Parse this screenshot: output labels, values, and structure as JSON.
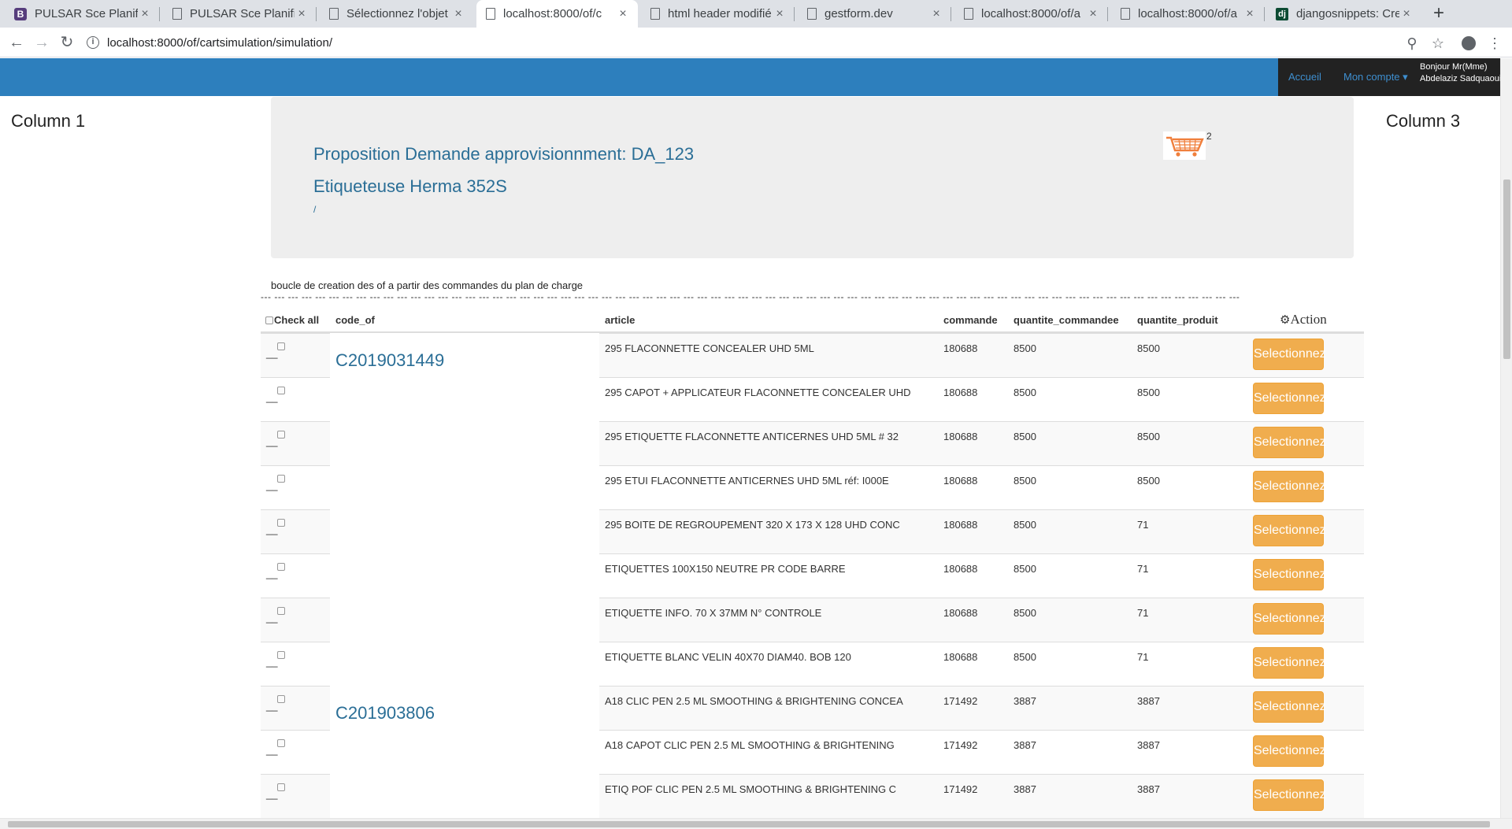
{
  "browser": {
    "tabs": [
      {
        "title": "PULSAR Sce Planific",
        "favicon": "bootstrap-icon"
      },
      {
        "title": "PULSAR Sce Planific",
        "favicon": "document-icon"
      },
      {
        "title": "Sélectionnez l'objet",
        "favicon": "document-icon"
      },
      {
        "title": "localhost:8000/of/c",
        "favicon": "document-icon",
        "active": true
      },
      {
        "title": "html header modifié",
        "favicon": "document-icon"
      },
      {
        "title": "gestform.dev",
        "favicon": "document-icon"
      },
      {
        "title": "localhost:8000/of/a",
        "favicon": "document-icon"
      },
      {
        "title": "localhost:8000/of/a",
        "favicon": "document-icon"
      },
      {
        "title": "djangosnippets: Crea",
        "favicon": "django-icon"
      }
    ],
    "close_glyph": "×",
    "new_tab_glyph": "+",
    "url": "localhost:8000/of/cartsimulation/simulation/",
    "info_glyph": "i"
  },
  "navbar": {
    "home": "Accueil",
    "account": "Mon compte ▾",
    "greeting_line1": "Bonjour Mr(Mme)",
    "greeting_line2": "Abdelaziz Sadquaoui",
    "color": "#2d7fbd"
  },
  "columns": {
    "left": "Column 1",
    "right": "Column 3"
  },
  "jumbotron": {
    "title": "Proposition Demande approvisionnment: DA_123",
    "subtitle": "Etiqueteuse Herma 352S",
    "path": "/",
    "cart_count": "2"
  },
  "loop_note": "boucle de creation des of a partir des commandes du plan de charge",
  "dashes": "--- --- --- --- --- --- --- --- --- --- --- --- --- --- --- --- --- --- --- --- --- --- --- --- --- --- --- --- --- --- --- --- --- --- --- --- --- --- --- --- --- --- --- --- --- --- --- --- --- --- --- --- --- --- --- --- --- --- --- --- --- --- --- --- --- --- --- --- --- --- --- ---",
  "table": {
    "headers": {
      "check_all": "Check all",
      "code_of": "code_of",
      "article": "article",
      "commande": "commande",
      "quantite_commandee": "quantite_commandee",
      "quantite_produit": "quantite_produit",
      "action": "Action"
    },
    "button_label": "Selectionnez",
    "row_marker": "__",
    "groups": [
      {
        "code_of": "C2019031449",
        "rows": [
          {
            "article": "295 FLACONNETTE CONCEALER UHD 5ML",
            "commande": "180688",
            "qte_cmd": "8500",
            "qte_prod": "8500"
          },
          {
            "article": "295 CAPOT + APPLICATEUR FLACONNETTE CONCEALER UHD",
            "commande": "180688",
            "qte_cmd": "8500",
            "qte_prod": "8500"
          },
          {
            "article": "295 ETIQUETTE FLACONNETTE ANTICERNES UHD 5ML # 32",
            "commande": "180688",
            "qte_cmd": "8500",
            "qte_prod": "8500"
          },
          {
            "article": "295 ETUI FLACONNETTE ANTICERNES UHD 5ML réf: I000E",
            "commande": "180688",
            "qte_cmd": "8500",
            "qte_prod": "8500"
          },
          {
            "article": "295 BOITE DE REGROUPEMENT 320 X 173 X 128 UHD CONC",
            "commande": "180688",
            "qte_cmd": "8500",
            "qte_prod": "71"
          },
          {
            "article": "ETIQUETTES 100X150 NEUTRE PR CODE BARRE",
            "commande": "180688",
            "qte_cmd": "8500",
            "qte_prod": "71"
          },
          {
            "article": "ETIQUETTE INFO. 70 X 37MM N° CONTROLE",
            "commande": "180688",
            "qte_cmd": "8500",
            "qte_prod": "71"
          },
          {
            "article": "ETIQUETTE BLANC VELIN 40X70 DIAM40. BOB 120",
            "commande": "180688",
            "qte_cmd": "8500",
            "qte_prod": "71"
          }
        ]
      },
      {
        "code_of": "C201903806",
        "rows": [
          {
            "article": "A18 CLIC PEN 2.5 ML SMOOTHING & BRIGHTENING CONCEA",
            "commande": "171492",
            "qte_cmd": "3887",
            "qte_prod": "3887"
          },
          {
            "article": "A18 CAPOT CLIC PEN 2.5 ML SMOOTHING & BRIGHTENING",
            "commande": "171492",
            "qte_cmd": "3887",
            "qte_prod": "3887"
          },
          {
            "article": "ETIQ POF CLIC PEN 2.5 ML SMOOTHING & BRIGHTENING C",
            "commande": "171492",
            "qte_cmd": "3887",
            "qte_prod": "3887"
          }
        ]
      }
    ]
  },
  "colors": {
    "button": "#f0ad4e",
    "link": "#2a6e96",
    "jumbotron": "#eeeeee"
  }
}
